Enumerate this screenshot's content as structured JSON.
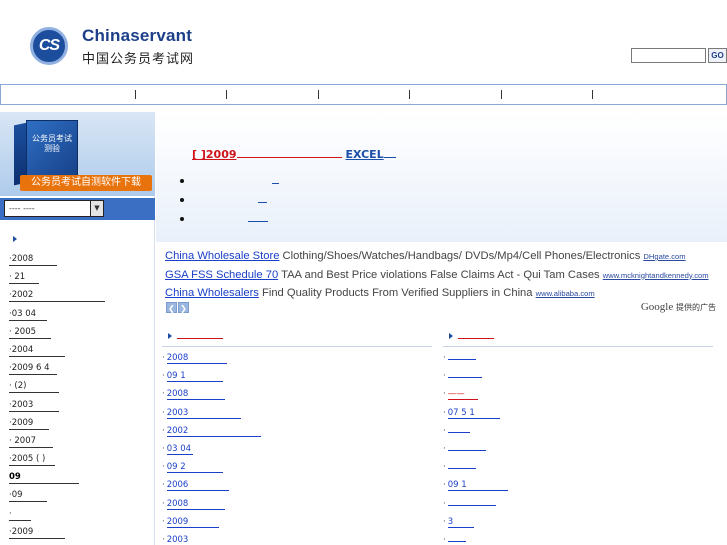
{
  "header": {
    "logo_mark": "CS",
    "logo_en": "Chinaservant",
    "logo_cn": "中国公务员考试网",
    "search_value": "",
    "go_label": "GO"
  },
  "sidebar": {
    "box_text": "公务员考试测验",
    "promo_banner": "公务员考试自测软件下载",
    "select_value": "---- ----",
    "select_arrow": "▼",
    "items": [
      {
        "text": "·2008 "
      },
      {
        "text": "· 21 "
      },
      {
        "text": "·2002 "
      },
      {
        "text": "·03 04 "
      },
      {
        "text": "· 2005 "
      },
      {
        "text": "·2004 "
      },
      {
        "text": "·2009 6 4 "
      },
      {
        "text": "· (2)"
      },
      {
        "text": "·2003 "
      },
      {
        "text": "·2009 "
      },
      {
        "text": "· 2007 "
      },
      {
        "text": "·2005 ( ) "
      },
      {
        "text": "09 "
      },
      {
        "text": "·09 "
      },
      {
        "text": "· "
      },
      {
        "text": "·2009 "
      }
    ]
  },
  "top": {
    "headline_red": "[ ]2009",
    "headline_blue": "EXCEL"
  },
  "ads": [
    {
      "title": "China Wholesale Store",
      "desc": " Clothing/Shoes/Watches/Handbags/ DVDs/Mp4/Cell Phones/Electronics ",
      "url": "DHgate.com"
    },
    {
      "title": "GSA FSS Schedule 70",
      "desc": " TAA and Best Price violations False Claims Act - Qui Tam Cases ",
      "url": "www.mcknightandkennedy.com"
    },
    {
      "title": "China Wholesalers",
      "desc": " Find Quality Products From Verified Suppliers in China ",
      "url": "www.alibaba.com"
    }
  ],
  "ads_footer": {
    "prev": "❮",
    "next": "❯",
    "google": "Google",
    "provided": "提供的广告"
  },
  "left_col": {
    "items": [
      {
        "prefix": "·",
        "text": "2008 "
      },
      {
        "prefix": "·",
        "text": "09 1"
      },
      {
        "prefix": "·",
        "text": "2008 "
      },
      {
        "prefix": "·",
        "text": "2003 "
      },
      {
        "prefix": "·",
        "text": "2002 "
      },
      {
        "prefix": "·",
        "text": "03 04 "
      },
      {
        "prefix": "·",
        "text": "09 2"
      },
      {
        "prefix": "·",
        "text": "2006 "
      },
      {
        "prefix": "·",
        "text": "2008 "
      },
      {
        "prefix": "·",
        "text": "2009 "
      },
      {
        "prefix": "·",
        "text": "2003 "
      }
    ]
  },
  "right_col": {
    "items": [
      {
        "prefix": "·",
        "text": " "
      },
      {
        "prefix": "·",
        "text": " "
      },
      {
        "prefix": "·",
        "text": " —— "
      },
      {
        "prefix": "·",
        "text": "07 5 1"
      },
      {
        "prefix": "·",
        "text": " "
      },
      {
        "prefix": "·",
        "text": " "
      },
      {
        "prefix": "·",
        "text": " "
      },
      {
        "prefix": "·",
        "text": "09 1"
      },
      {
        "prefix": "·",
        "text": " "
      },
      {
        "prefix": "·",
        "text": " 3"
      },
      {
        "prefix": "·",
        "text": " "
      }
    ]
  },
  "colors": {
    "brand_blue": "#1d4e9e",
    "headline_red": "#d0131b",
    "link_blue": "#1a3fc8",
    "promo_orange": "#e8720c"
  }
}
